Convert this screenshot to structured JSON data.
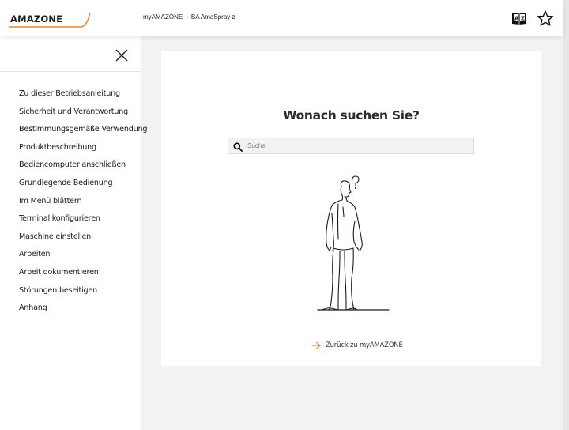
{
  "header": {
    "logo_text": "AMAZONE",
    "breadcrumb": [
      "myAMAZONE",
      "BA AmaSpray z"
    ],
    "breadcrumb_separator": "›",
    "icons": [
      "dictionary-book-icon",
      "star-icon"
    ]
  },
  "sidebar": {
    "close_icon": "close-icon",
    "items": [
      {
        "label": "Zu dieser Betriebsanleitung"
      },
      {
        "label": "Sicherheit und Verantwortung"
      },
      {
        "label": "Bestimmungsgemäße Verwendung"
      },
      {
        "label": "Produktbeschreibung"
      },
      {
        "label": "Bediencomputer anschließen"
      },
      {
        "label": "Grundlegende Bedienung"
      },
      {
        "label": "Im Menü blättern"
      },
      {
        "label": "Terminal konfigurieren"
      },
      {
        "label": "Maschine einstellen"
      },
      {
        "label": "Arbeiten"
      },
      {
        "label": "Arbeit dokumentieren"
      },
      {
        "label": "Störungen beseitigen"
      },
      {
        "label": "Anhang"
      }
    ]
  },
  "main": {
    "title": "Wonach suchen Sie?",
    "search": {
      "placeholder": "Suche",
      "value": "",
      "icon": "search-icon"
    },
    "illustration": "thinking-person-illustration",
    "back_link": "Zurück zu myAMAZONE"
  },
  "colors": {
    "accent": "#e8872c",
    "background": "#f2f2f2",
    "card": "#ffffff"
  }
}
